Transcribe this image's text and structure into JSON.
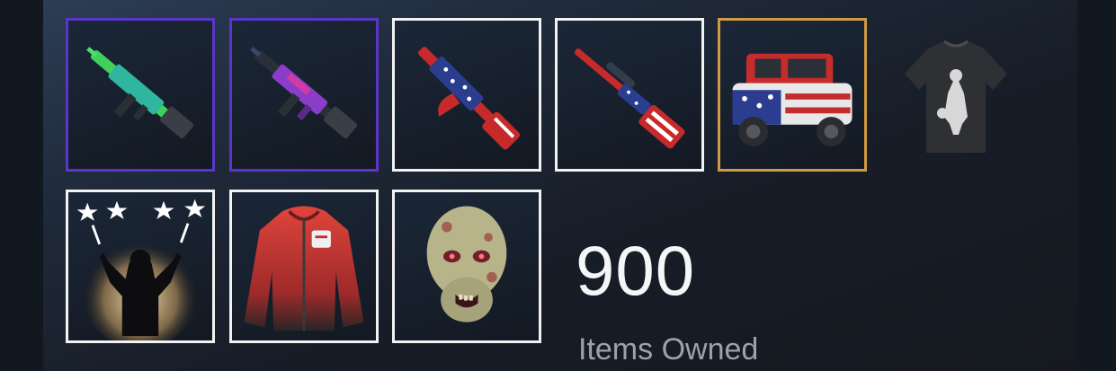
{
  "inventory": {
    "items": [
      {
        "name": "green-assault-rifle-skin",
        "rarity": "epic",
        "color": "#5b35c8"
      },
      {
        "name": "purple-assault-rifle-skin",
        "rarity": "epic",
        "color": "#5b35c8"
      },
      {
        "name": "flag-ak-rifle-skin",
        "rarity": "common",
        "color": "#f2f2f2"
      },
      {
        "name": "flag-sniper-rifle-skin",
        "rarity": "common",
        "color": "#f2f2f2"
      },
      {
        "name": "flag-jeep-skin",
        "rarity": "legendary",
        "color": "#d19a44"
      },
      {
        "name": "black-tshirt",
        "rarity": "none",
        "color": ""
      },
      {
        "name": "celebration-emote",
        "rarity": "common",
        "color": "#f2f2f2"
      },
      {
        "name": "red-hoodie",
        "rarity": "common",
        "color": "#f2f2f2"
      },
      {
        "name": "zombie-mask",
        "rarity": "common",
        "color": "#f2f2f2"
      }
    ],
    "items_owned_count": "900",
    "items_owned_label": "Items Owned"
  }
}
